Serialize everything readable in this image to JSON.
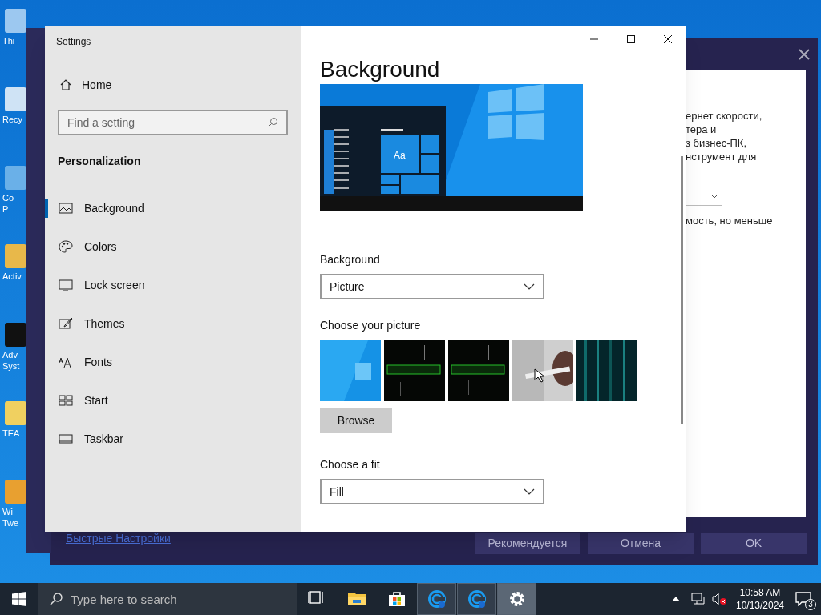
{
  "desktop_icons": [
    {
      "label": "Thi"
    },
    {
      "label": "Recy"
    },
    {
      "label": "Co\nP"
    },
    {
      "label": "Activ"
    },
    {
      "label": "Adv\nSyst"
    },
    {
      "label": "TEA"
    },
    {
      "label": "Wi\nTwe"
    }
  ],
  "back_window": {
    "text_lines": [
      "ернет скорости,",
      "тера и",
      "з бизнес-ПК,",
      "нструмент для"
    ],
    "note": "мость, но меньше",
    "link": "Быстрые Настройки",
    "buttons": [
      {
        "label": "Рекомендуется"
      },
      {
        "label": "Отмена"
      },
      {
        "label": "OK"
      }
    ]
  },
  "settings": {
    "title": "Settings",
    "home": "Home",
    "search_placeholder": "Find a setting",
    "section": "Personalization",
    "items": [
      {
        "label": "Background",
        "selected": true
      },
      {
        "label": "Colors",
        "selected": false
      },
      {
        "label": "Lock screen",
        "selected": false
      },
      {
        "label": "Themes",
        "selected": false
      },
      {
        "label": "Fonts",
        "selected": false
      },
      {
        "label": "Start",
        "selected": false
      },
      {
        "label": "Taskbar",
        "selected": false
      }
    ],
    "heading": "Background",
    "preview_sample": "Aa",
    "background_label": "Background",
    "background_value": "Picture",
    "choose_label": "Choose your picture",
    "browse": "Browse",
    "fit_label": "Choose a fit",
    "fit_value": "Fill"
  },
  "taskbar": {
    "search_placeholder": "Type here to search",
    "apps": [
      {
        "kind": "taskview",
        "running": false,
        "selected": false
      },
      {
        "kind": "explorer",
        "running": false,
        "selected": false
      },
      {
        "kind": "store",
        "running": false,
        "selected": false
      },
      {
        "kind": "app",
        "running": true,
        "selected": false
      },
      {
        "kind": "app",
        "running": true,
        "selected": false
      },
      {
        "kind": "settings",
        "running": true,
        "selected": true
      }
    ],
    "time": "10:58 AM",
    "date": "10/13/2024",
    "notifications": "3"
  }
}
